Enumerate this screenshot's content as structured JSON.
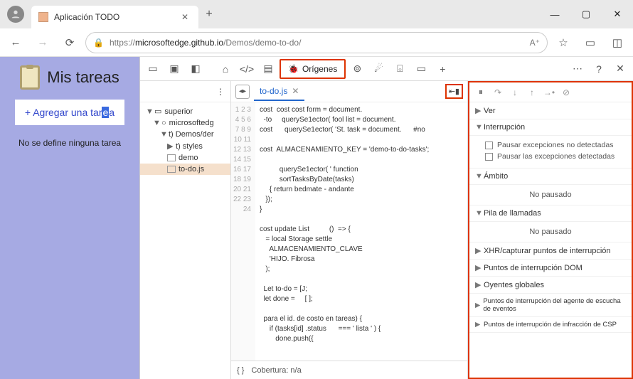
{
  "browser": {
    "tab_title": "Aplicación TODO",
    "url_host": "microsoftedge.github.io",
    "url_path": "/Demos/demo-to-do/",
    "url_prefix": "https://"
  },
  "app": {
    "title": "Mis tareas",
    "add_button_prefix": "+ Agregar una tar",
    "add_button_highlight": "e",
    "add_button_suffix": "a",
    "empty_message": "No se define ninguna tarea"
  },
  "devtools": {
    "active_tab": "Orígenes",
    "tree": {
      "top": "superior",
      "domain": "microsoftedg",
      "folder1": "t) Demos/der",
      "folder2": "t) styles",
      "file1": "demo",
      "file2": "to-do.js"
    },
    "editor": {
      "open_file": "to-do.js",
      "lines": [
        "cost  cost cost form = document.",
        "  -to     querySe1ector( fool list = document.",
        "cost      querySe1ector( 'St. task = document.      #no",
        "",
        "cost  ALMACENAMIENTO_KEY = 'demo-to-do-tasks';",
        "",
        "          querySe1ector( ' function",
        "          sortTasksByDate(tasks)",
        "     { return bedmate - andante",
        "   });",
        "}",
        "",
        "cost update List          ()  => {",
        "   = local Storage settle",
        "     ALMACENAMIENTO_CLAVE",
        "     'HIJO. Fibrosa",
        "   );",
        "",
        "  Let to-do = [J;",
        "  let done =     [ ];",
        "",
        "  para el id. de costo en tareas) {",
        "     if (tasks[id] .status      === ' lista ' ) {",
        "        done.push({"
      ],
      "coverage_label": "Cobertura: n/a"
    },
    "debug": {
      "sections": {
        "watch": "Ver",
        "breakpoints": "Interrupción",
        "pause_uncaught": "Pausar excepciones no detectadas",
        "pause_caught": "Pausar las excepciones detectadas",
        "scope": "Ámbito",
        "not_paused": "No pausado",
        "callstack": "Pila de llamadas",
        "xhr": "XHR/capturar puntos de interrupción",
        "dom": "Puntos de interrupción DOM",
        "listeners": "Oyentes globales",
        "event_listener": "Puntos de interrupción del agente de escucha de eventos",
        "csp": "Puntos de interrupción de infracción de CSP"
      }
    }
  }
}
